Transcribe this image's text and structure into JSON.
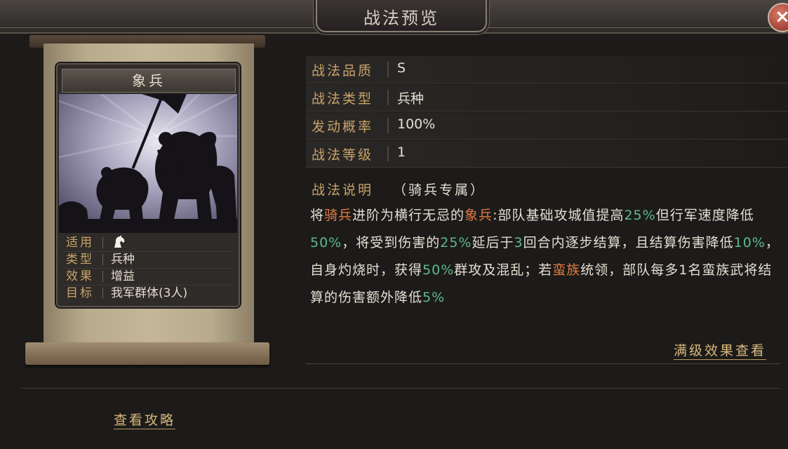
{
  "dialog": {
    "title": "战法预览",
    "close_label": "×"
  },
  "card": {
    "name": "象兵",
    "attributes": [
      {
        "key": "适用",
        "value": "",
        "icon": "horse-icon"
      },
      {
        "key": "类型",
        "value": "兵种"
      },
      {
        "key": "效果",
        "value": "增益"
      },
      {
        "key": "目标",
        "value": "我军群体(3人)"
      }
    ]
  },
  "info": [
    {
      "key": "战法品质",
      "value": "S"
    },
    {
      "key": "战法类型",
      "value": "兵种"
    },
    {
      "key": "发动概率",
      "value": "100%"
    },
    {
      "key": "战法等级",
      "value": "1"
    }
  ],
  "description": {
    "heading": "战法说明",
    "note": "（骑兵专属）",
    "segments": [
      {
        "t": "将",
        "c": ""
      },
      {
        "t": "骑兵",
        "c": "orange"
      },
      {
        "t": "进阶为横行无忌的",
        "c": ""
      },
      {
        "t": "象兵",
        "c": "orange"
      },
      {
        "t": ":部队基础攻城值提高",
        "c": ""
      },
      {
        "t": "25%",
        "c": "green"
      },
      {
        "t": "但行军速度降低",
        "c": ""
      },
      {
        "t": "50%",
        "c": "green"
      },
      {
        "t": "，将受到伤害的",
        "c": ""
      },
      {
        "t": "25%",
        "c": "green"
      },
      {
        "t": "延后于",
        "c": ""
      },
      {
        "t": "3",
        "c": "green"
      },
      {
        "t": "回合内逐步结算，且结算伤害降低",
        "c": ""
      },
      {
        "t": "10%",
        "c": "green"
      },
      {
        "t": "，自身灼烧时，获得",
        "c": ""
      },
      {
        "t": "50%",
        "c": "green"
      },
      {
        "t": "群攻及混乱；若",
        "c": ""
      },
      {
        "t": "蛮族",
        "c": "orange"
      },
      {
        "t": "统领，部队每多1名蛮族武将结算的伤害额外降低",
        "c": ""
      },
      {
        "t": "5%",
        "c": "green"
      }
    ]
  },
  "links": {
    "full_effect": "满级效果查看",
    "guide": "查看攻略"
  },
  "colors": {
    "orange": "#e07a40",
    "green": "#5fb98a",
    "gold": "#c9a36a"
  }
}
